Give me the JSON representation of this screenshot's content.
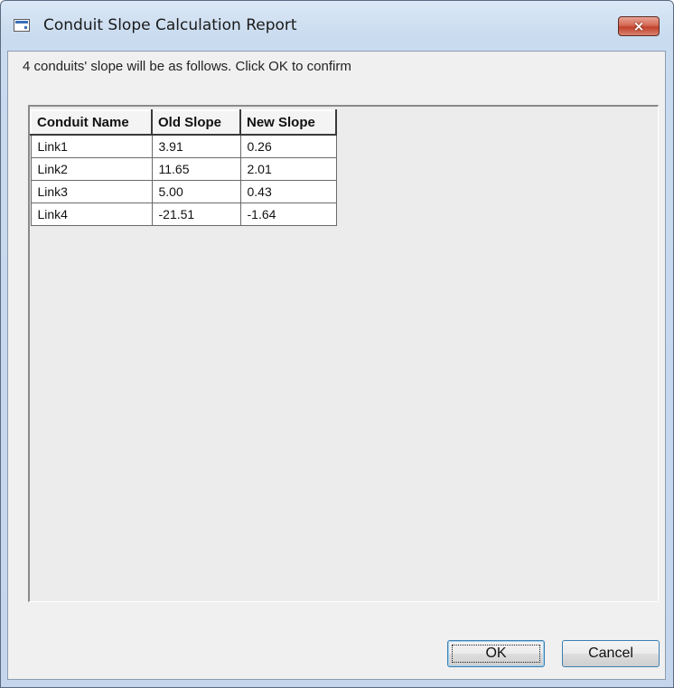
{
  "window": {
    "title": "Conduit Slope Calculation Report",
    "close_label": "×"
  },
  "message": "4 conduits' slope will be as follows. Click OK to confirm",
  "table": {
    "headers": [
      "Conduit Name",
      "Old Slope",
      "New Slope"
    ],
    "rows": [
      [
        "Link1",
        "3.91",
        "0.26"
      ],
      [
        "Link2",
        "11.65",
        "2.01"
      ],
      [
        "Link3",
        "5.00",
        "0.43"
      ],
      [
        "Link4",
        "-21.51",
        "-1.64"
      ]
    ]
  },
  "buttons": {
    "ok_label": "OK",
    "cancel_label": "Cancel"
  },
  "icons": {
    "app": "window-app-icon",
    "close": "close-icon"
  },
  "colors": {
    "close_button": "#c2412b",
    "button_focus_border": "#3c7fb1",
    "client_background": "#f0f0f0"
  }
}
